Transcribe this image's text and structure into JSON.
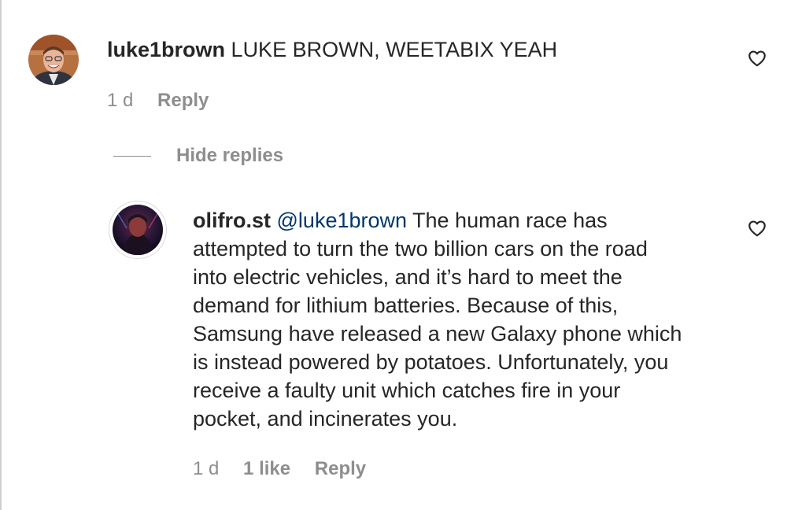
{
  "comments": [
    {
      "username": "luke1brown",
      "text": "LUKE BROWN, WEETABIX YEAH",
      "time": "1 d",
      "reply_label": "Reply"
    }
  ],
  "hide_replies_label": "Hide replies",
  "reply": {
    "username": "olifro.st",
    "mention": "@luke1brown",
    "text_lines": [
      "The human race has",
      "attempted to turn the two billion cars on the road",
      "into electric vehicles, and it’s hard to meet the",
      "demand for lithium batteries. Because of this,",
      "Samsung have released a new Galaxy phone which",
      "is instead powered by potatoes. Unfortunately, you",
      "receive a faulty unit which catches fire in your",
      "pocket, and incinerates you."
    ],
    "time": "1 d",
    "likes": "1 like",
    "reply_label": "Reply"
  },
  "icons": {
    "like": "heart-outline-icon"
  },
  "colors": {
    "text": "#262626",
    "secondary": "#8e8e8e",
    "mention": "#00376b"
  }
}
